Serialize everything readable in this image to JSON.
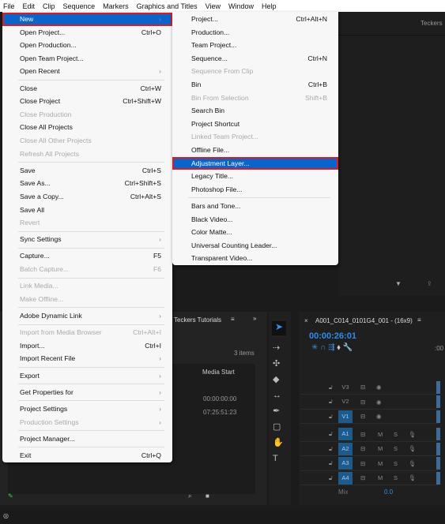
{
  "menubar": [
    "File",
    "Edit",
    "Clip",
    "Sequence",
    "Markers",
    "Graphics and Titles",
    "View",
    "Window",
    "Help"
  ],
  "file_menu": [
    {
      "label": "New",
      "shortcut": "",
      "arrow": true,
      "state": "highlighted"
    },
    {
      "label": "Open Project...",
      "shortcut": "Ctrl+O"
    },
    {
      "label": "Open Production...",
      "shortcut": ""
    },
    {
      "label": "Open Team Project...",
      "shortcut": ""
    },
    {
      "label": "Open Recent",
      "shortcut": "",
      "arrow": true
    },
    {
      "sep": true
    },
    {
      "label": "Close",
      "shortcut": "Ctrl+W"
    },
    {
      "label": "Close Project",
      "shortcut": "Ctrl+Shift+W"
    },
    {
      "label": "Close Production",
      "shortcut": "",
      "disabled": true
    },
    {
      "label": "Close All Projects",
      "shortcut": ""
    },
    {
      "label": "Close All Other Projects",
      "shortcut": "",
      "disabled": true
    },
    {
      "label": "Refresh All Projects",
      "shortcut": "",
      "disabled": true
    },
    {
      "sep": true
    },
    {
      "label": "Save",
      "shortcut": "Ctrl+S"
    },
    {
      "label": "Save As...",
      "shortcut": "Ctrl+Shift+S"
    },
    {
      "label": "Save a Copy...",
      "shortcut": "Ctrl+Alt+S"
    },
    {
      "label": "Save All",
      "shortcut": ""
    },
    {
      "label": "Revert",
      "shortcut": "",
      "disabled": true
    },
    {
      "sep": true
    },
    {
      "label": "Sync Settings",
      "shortcut": "",
      "arrow": true
    },
    {
      "sep": true
    },
    {
      "label": "Capture...",
      "shortcut": "F5"
    },
    {
      "label": "Batch Capture...",
      "shortcut": "F6",
      "disabled": true
    },
    {
      "sep": true
    },
    {
      "label": "Link Media...",
      "shortcut": "",
      "disabled": true
    },
    {
      "label": "Make Offline...",
      "shortcut": "",
      "disabled": true
    },
    {
      "sep": true
    },
    {
      "label": "Adobe Dynamic Link",
      "shortcut": "",
      "arrow": true
    },
    {
      "sep": true
    },
    {
      "label": "Import from Media Browser",
      "shortcut": "Ctrl+Alt+I",
      "disabled": true
    },
    {
      "label": "Import...",
      "shortcut": "Ctrl+I"
    },
    {
      "label": "Import Recent File",
      "shortcut": "",
      "arrow": true
    },
    {
      "sep": true
    },
    {
      "label": "Export",
      "shortcut": "",
      "arrow": true
    },
    {
      "sep": true
    },
    {
      "label": "Get Properties for",
      "shortcut": "",
      "arrow": true
    },
    {
      "sep": true
    },
    {
      "label": "Project Settings",
      "shortcut": "",
      "arrow": true
    },
    {
      "label": "Production Settings",
      "shortcut": "",
      "arrow": true,
      "disabled": true
    },
    {
      "sep": true
    },
    {
      "label": "Project Manager...",
      "shortcut": ""
    },
    {
      "sep": true
    },
    {
      "label": "Exit",
      "shortcut": "Ctrl+Q"
    }
  ],
  "new_submenu": [
    {
      "label": "Project...",
      "shortcut": "Ctrl+Alt+N"
    },
    {
      "label": "Production...",
      "shortcut": ""
    },
    {
      "label": "Team Project...",
      "shortcut": ""
    },
    {
      "label": "Sequence...",
      "shortcut": "Ctrl+N"
    },
    {
      "label": "Sequence From Clip",
      "shortcut": "",
      "disabled": true
    },
    {
      "label": "Bin",
      "shortcut": "Ctrl+B"
    },
    {
      "label": "Bin From Selection",
      "shortcut": "Shift+B",
      "disabled": true
    },
    {
      "label": "Search Bin",
      "shortcut": ""
    },
    {
      "label": "Project Shortcut",
      "shortcut": ""
    },
    {
      "label": "Linked Team Project...",
      "shortcut": "",
      "disabled": true
    },
    {
      "label": "Offline File...",
      "shortcut": ""
    },
    {
      "label": "Adjustment Layer...",
      "shortcut": "",
      "state": "highlighted"
    },
    {
      "label": "Legacy Title...",
      "shortcut": ""
    },
    {
      "label": "Photoshop File...",
      "shortcut": ""
    },
    {
      "sep": true
    },
    {
      "label": "Bars and Tone...",
      "shortcut": ""
    },
    {
      "label": "Black Video...",
      "shortcut": ""
    },
    {
      "label": "Color Matte...",
      "shortcut": ""
    },
    {
      "label": "Universal Counting Leader...",
      "shortcut": ""
    },
    {
      "label": "Transparent Video...",
      "shortcut": ""
    }
  ],
  "top_panel": {
    "tab": "Teckers"
  },
  "project_panel": {
    "tab": "Teckers Tutorials",
    "item_count": "3 items",
    "column": "Media Start",
    "rows": [
      "00:00:00:00",
      "07:25:51:23"
    ]
  },
  "timeline": {
    "sequence": "A001_C014_0101G4_001 - (16x9)",
    "timecode": "00:00:26:01",
    "video_tracks": [
      {
        "name": "V3",
        "active": false
      },
      {
        "name": "V2",
        "active": false
      },
      {
        "name": "V1",
        "active": true
      }
    ],
    "audio_tracks": [
      "A1",
      "A2",
      "A3",
      "A4"
    ],
    "mix_label": "Mix",
    "mix_value": "0.0",
    "ruler": ":00"
  },
  "colors": {
    "highlight": "#0a64c9",
    "outline": "#d0202a",
    "timecode": "#2d8ceb"
  }
}
